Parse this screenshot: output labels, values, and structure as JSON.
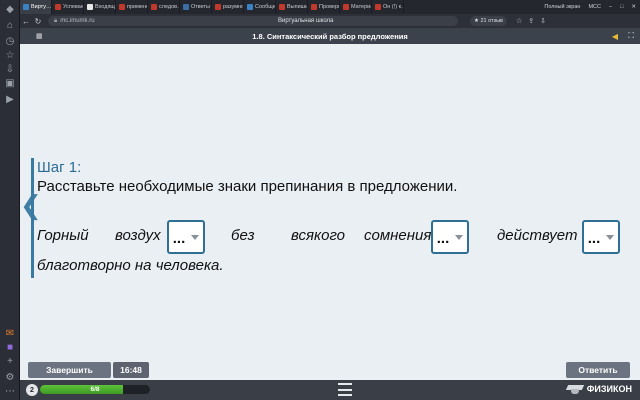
{
  "browser": {
    "tabs": [
      {
        "label": "Вирту…",
        "color": "#3b82c4",
        "active": true
      },
      {
        "label": "Успеваемость",
        "color": "#c0392b"
      },
      {
        "label": "Входящие",
        "color": "#e8e8e8"
      },
      {
        "label": "применение",
        "color": "#c0392b"
      },
      {
        "label": "следов…",
        "color": "#c0392b"
      },
      {
        "label": "Ответы з…",
        "color": "#3b6ea5"
      },
      {
        "label": "разумно",
        "color": "#c0392b"
      },
      {
        "label": "Сообщения",
        "color": "#3b82c4"
      },
      {
        "label": "Выпиши",
        "color": "#c0392b"
      },
      {
        "label": "Проверка",
        "color": "#c0392b"
      },
      {
        "label": "Материал",
        "color": "#c0392b"
      },
      {
        "label": "Он (!) к…",
        "color": "#c0392b"
      }
    ],
    "tab_right": [
      "Полный экран",
      "MCC"
    ],
    "url_host": "mc.imumk.ru",
    "page_title": "Виртуальная школа",
    "rating": "★ 21 отзыв"
  },
  "header": {
    "title": "1.8. Синтаксический разбор предложения"
  },
  "task": {
    "step_label": "Шаг 1:",
    "instruction": "Расставьте необходимые знаки препинания в предложении.",
    "words": [
      "Горный",
      "воздух",
      "без",
      "всякого",
      "сомнения",
      "действует"
    ],
    "line2": "благотворно на человека.",
    "dropdowns": [
      {
        "value": "..."
      },
      {
        "value": "..."
      },
      {
        "value": "..."
      }
    ]
  },
  "controls": {
    "finish_label": "Завершить",
    "timer": "16:48",
    "answer_label": "Ответить"
  },
  "footer": {
    "step_number": "2",
    "progress_text": "6/8",
    "progress_fraction": 0.75,
    "brand": "ФИЗИКОН"
  },
  "colors": {
    "accent": "#2f6f93",
    "progress": "#4caf2f"
  }
}
